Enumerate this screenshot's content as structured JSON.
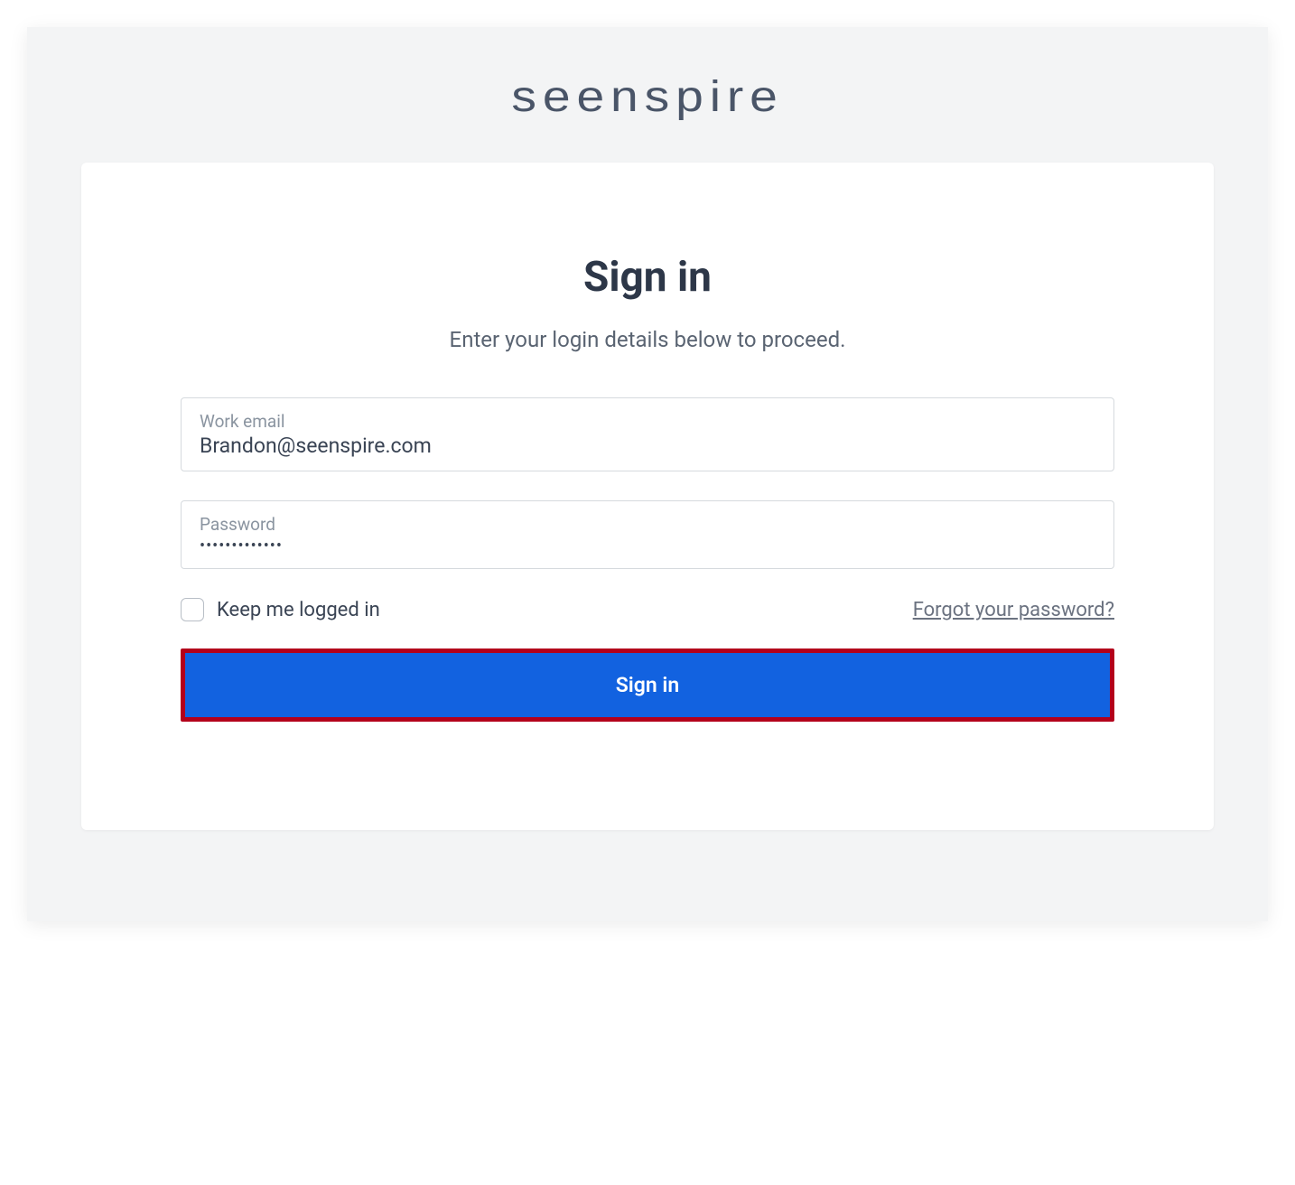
{
  "brand": {
    "logo_text": "seenspire"
  },
  "form": {
    "title": "Sign in",
    "subtitle": "Enter your login details below to proceed.",
    "email": {
      "label": "Work email",
      "value": "Brandon@seenspire.com"
    },
    "password": {
      "label": "Password",
      "value": "•••••••••••••"
    },
    "keep_logged_label": "Keep me logged in",
    "keep_logged_checked": false,
    "forgot_link": "Forgot your password?",
    "submit_label": "Sign in"
  }
}
